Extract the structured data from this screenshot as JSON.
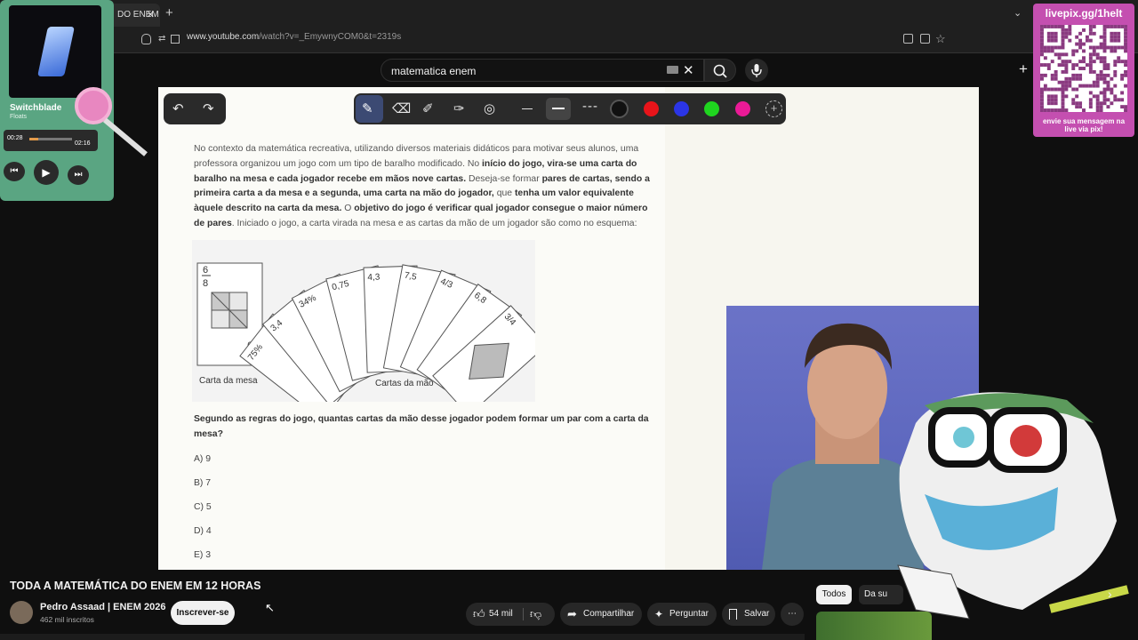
{
  "browser": {
    "tab_title": "DO ENEM",
    "url_host": "www.youtube.com",
    "url_path": "/watch?v=_EmywnyCOM0&t=2319s"
  },
  "youtube": {
    "search_value": "matematica enem"
  },
  "question": {
    "p1": "No contexto da matemática recreativa, utilizando diversos materiais didáticos para motivar seus alunos, uma professora organizou um jogo com um tipo de baralho modificado. No ",
    "b1": "início do jogo, vira-se uma carta do baralho na mesa e cada jogador recebe em mãos nove cartas.",
    "p2": " Deseja-se formar ",
    "b2": "pares de cartas, sendo a primeira carta a da mesa e a segunda, uma carta na mão do jogador,",
    "p3": " que ",
    "b3": "tenha um valor equivalente àquele descrito na carta da mesa.",
    "p4": " O ",
    "b4": "objetivo do jogo é verificar qual jogador consegue o maior número de pares",
    "p5": ". Iniciado o jogo, a carta virada na mesa e as cartas da mão de um jogador são como no esquema:",
    "prompt": "Segundo as regras do jogo, quantas cartas da mão desse jogador podem formar um par com a carta da mesa?",
    "options": [
      "A) 9",
      "B) 7",
      "C) 5",
      "D) 4",
      "E) 3"
    ],
    "table_card_label": "Carta da mesa",
    "hand_label": "Cartas da mão",
    "table_card_num": "6",
    "table_card_den": "8",
    "hand_cards": [
      "75%",
      "3,4",
      "34%",
      "0,75",
      "4,3",
      "7,5",
      "4/3",
      "6,8",
      "3/4"
    ]
  },
  "music": {
    "track": "Switchblade",
    "artist": "Floats",
    "elapsed": "00:28",
    "total": "02:16",
    "progress": 0.2
  },
  "qr": {
    "url": "livepix.gg/1helt",
    "caption": "envie sua mensagem na live via pix!"
  },
  "video": {
    "title": "TODA A MATEMÁTICA DO ENEM EM 12 HORAS",
    "channel": "Pedro Assaad | ENEM 2026",
    "subscribers": "462 mil inscritos",
    "subscribe_label": "Inscrever-se",
    "likes": "54 mil",
    "share_label": "Compartilhar",
    "ask_label": "Perguntar",
    "save_label": "Salvar"
  },
  "chips": {
    "all": "Todos",
    "second": "Da su"
  },
  "colors": {
    "draw_black": "#111111",
    "draw_red": "#e8141a",
    "draw_blue": "#2b35e6",
    "draw_green": "#1fd51f",
    "draw_magenta": "#ea1a96"
  }
}
